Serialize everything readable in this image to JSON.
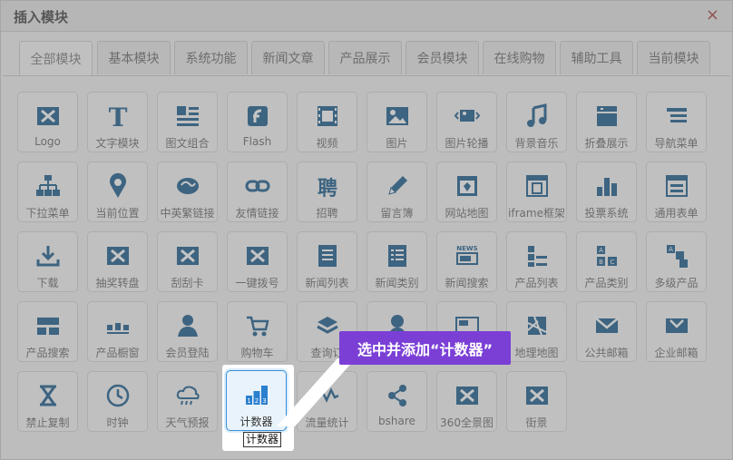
{
  "dialog": {
    "title": "插入模块",
    "close": "×"
  },
  "tabs": [
    "全部模块",
    "基本模块",
    "系统功能",
    "新闻文章",
    "产品展示",
    "会员模块",
    "在线购物",
    "辅助工具",
    "当前模块"
  ],
  "active_tab": 0,
  "tiles": [
    {
      "label": "Logo",
      "icon": "logo-icon"
    },
    {
      "label": "文字模块",
      "icon": "text-icon"
    },
    {
      "label": "图文组合",
      "icon": "image-text-icon"
    },
    {
      "label": "Flash",
      "icon": "flash-icon"
    },
    {
      "label": "视频",
      "icon": "video-icon"
    },
    {
      "label": "图片",
      "icon": "image-icon"
    },
    {
      "label": "图片轮播",
      "icon": "carousel-icon"
    },
    {
      "label": "背景音乐",
      "icon": "music-icon"
    },
    {
      "label": "折叠展示",
      "icon": "accordion-icon"
    },
    {
      "label": "导航菜单",
      "icon": "nav-menu-icon"
    },
    {
      "label": "下拉菜单",
      "icon": "dropdown-icon"
    },
    {
      "label": "当前位置",
      "icon": "location-icon"
    },
    {
      "label": "中英繁链接",
      "icon": "language-icon"
    },
    {
      "label": "友情链接",
      "icon": "link-icon"
    },
    {
      "label": "招聘",
      "icon": "recruit-icon"
    },
    {
      "label": "留言簿",
      "icon": "guestbook-icon"
    },
    {
      "label": "网站地图",
      "icon": "sitemap-icon"
    },
    {
      "label": "iframe框架",
      "icon": "iframe-icon"
    },
    {
      "label": "投票系统",
      "icon": "vote-icon"
    },
    {
      "label": "通用表单",
      "icon": "form-icon"
    },
    {
      "label": "下载",
      "icon": "download-icon"
    },
    {
      "label": "抽奖转盘",
      "icon": "lottery-icon"
    },
    {
      "label": "刮刮卡",
      "icon": "scratch-card-icon"
    },
    {
      "label": "一键拨号",
      "icon": "dial-icon"
    },
    {
      "label": "新闻列表",
      "icon": "news-list-icon"
    },
    {
      "label": "新闻类别",
      "icon": "news-category-icon"
    },
    {
      "label": "新闻搜索",
      "icon": "news-search-icon"
    },
    {
      "label": "产品列表",
      "icon": "product-list-icon"
    },
    {
      "label": "产品类别",
      "icon": "product-category-icon"
    },
    {
      "label": "多级产品",
      "icon": "multilevel-product-icon"
    },
    {
      "label": "产品搜索",
      "icon": "product-search-icon"
    },
    {
      "label": "产品橱窗",
      "icon": "product-window-icon"
    },
    {
      "label": "会员登陆",
      "icon": "member-login-icon"
    },
    {
      "label": "购物车",
      "icon": "cart-icon"
    },
    {
      "label": "查询订",
      "icon": "order-query-icon"
    },
    {
      "label": "",
      "icon": "member-icon"
    },
    {
      "label": "",
      "icon": "map-icon"
    },
    {
      "label": "地理地图",
      "icon": "geo-map-icon"
    },
    {
      "label": "公共邮箱",
      "icon": "mail-icon"
    },
    {
      "label": "企业邮箱",
      "icon": "enterprise-mail-icon"
    },
    {
      "label": "禁止复制",
      "icon": "no-copy-icon"
    },
    {
      "label": "时钟",
      "icon": "clock-icon"
    },
    {
      "label": "天气预报",
      "icon": "weather-icon"
    },
    {
      "label": "计数器",
      "icon": "counter-icon"
    },
    {
      "label": "流量统计",
      "icon": "traffic-icon"
    },
    {
      "label": "bshare",
      "icon": "share-icon"
    },
    {
      "label": "360全景图",
      "icon": "panorama-icon"
    },
    {
      "label": "街景",
      "icon": "street-view-icon"
    }
  ],
  "highlight_index": 43,
  "tooltip": "计数器",
  "callout": "选中并添加“计数器”",
  "colors": {
    "icon": "#2f6a97",
    "highlight": "#3a8fd9",
    "callout": "#7b3fd6"
  }
}
